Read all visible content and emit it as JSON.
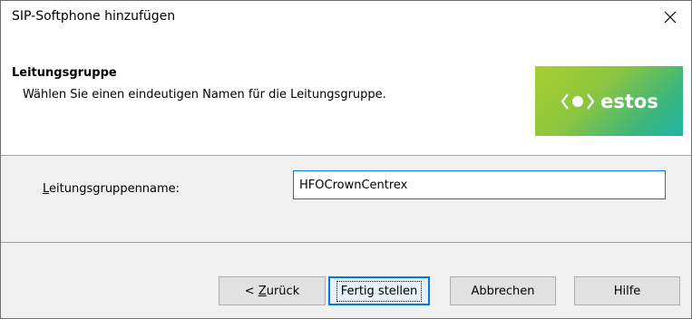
{
  "window": {
    "title": "SIP-Softphone hinzufügen",
    "close_icon": "close-icon"
  },
  "header": {
    "title": "Leitungsgruppe",
    "subtitle": "Wählen Sie einen eindeutigen Namen für die Leitungsgruppe.",
    "logo_text": "estos",
    "logo_colors": [
      "#a8cf2e",
      "#3db67a",
      "#1fb3a7"
    ]
  },
  "form": {
    "label_prefix": "L",
    "label_rest": "eitungsgruppenname:",
    "value": "HFOCrownCentrex"
  },
  "buttons": {
    "back_prefix": "< ",
    "back_accel": "Z",
    "back_rest": "urück",
    "finish": "Fertig stellen",
    "cancel": "Abbrechen",
    "help": "Hilfe"
  },
  "colors": {
    "accent": "#0078d7",
    "header_bg": "#ffffff",
    "body_bg": "#f0f0f0"
  }
}
